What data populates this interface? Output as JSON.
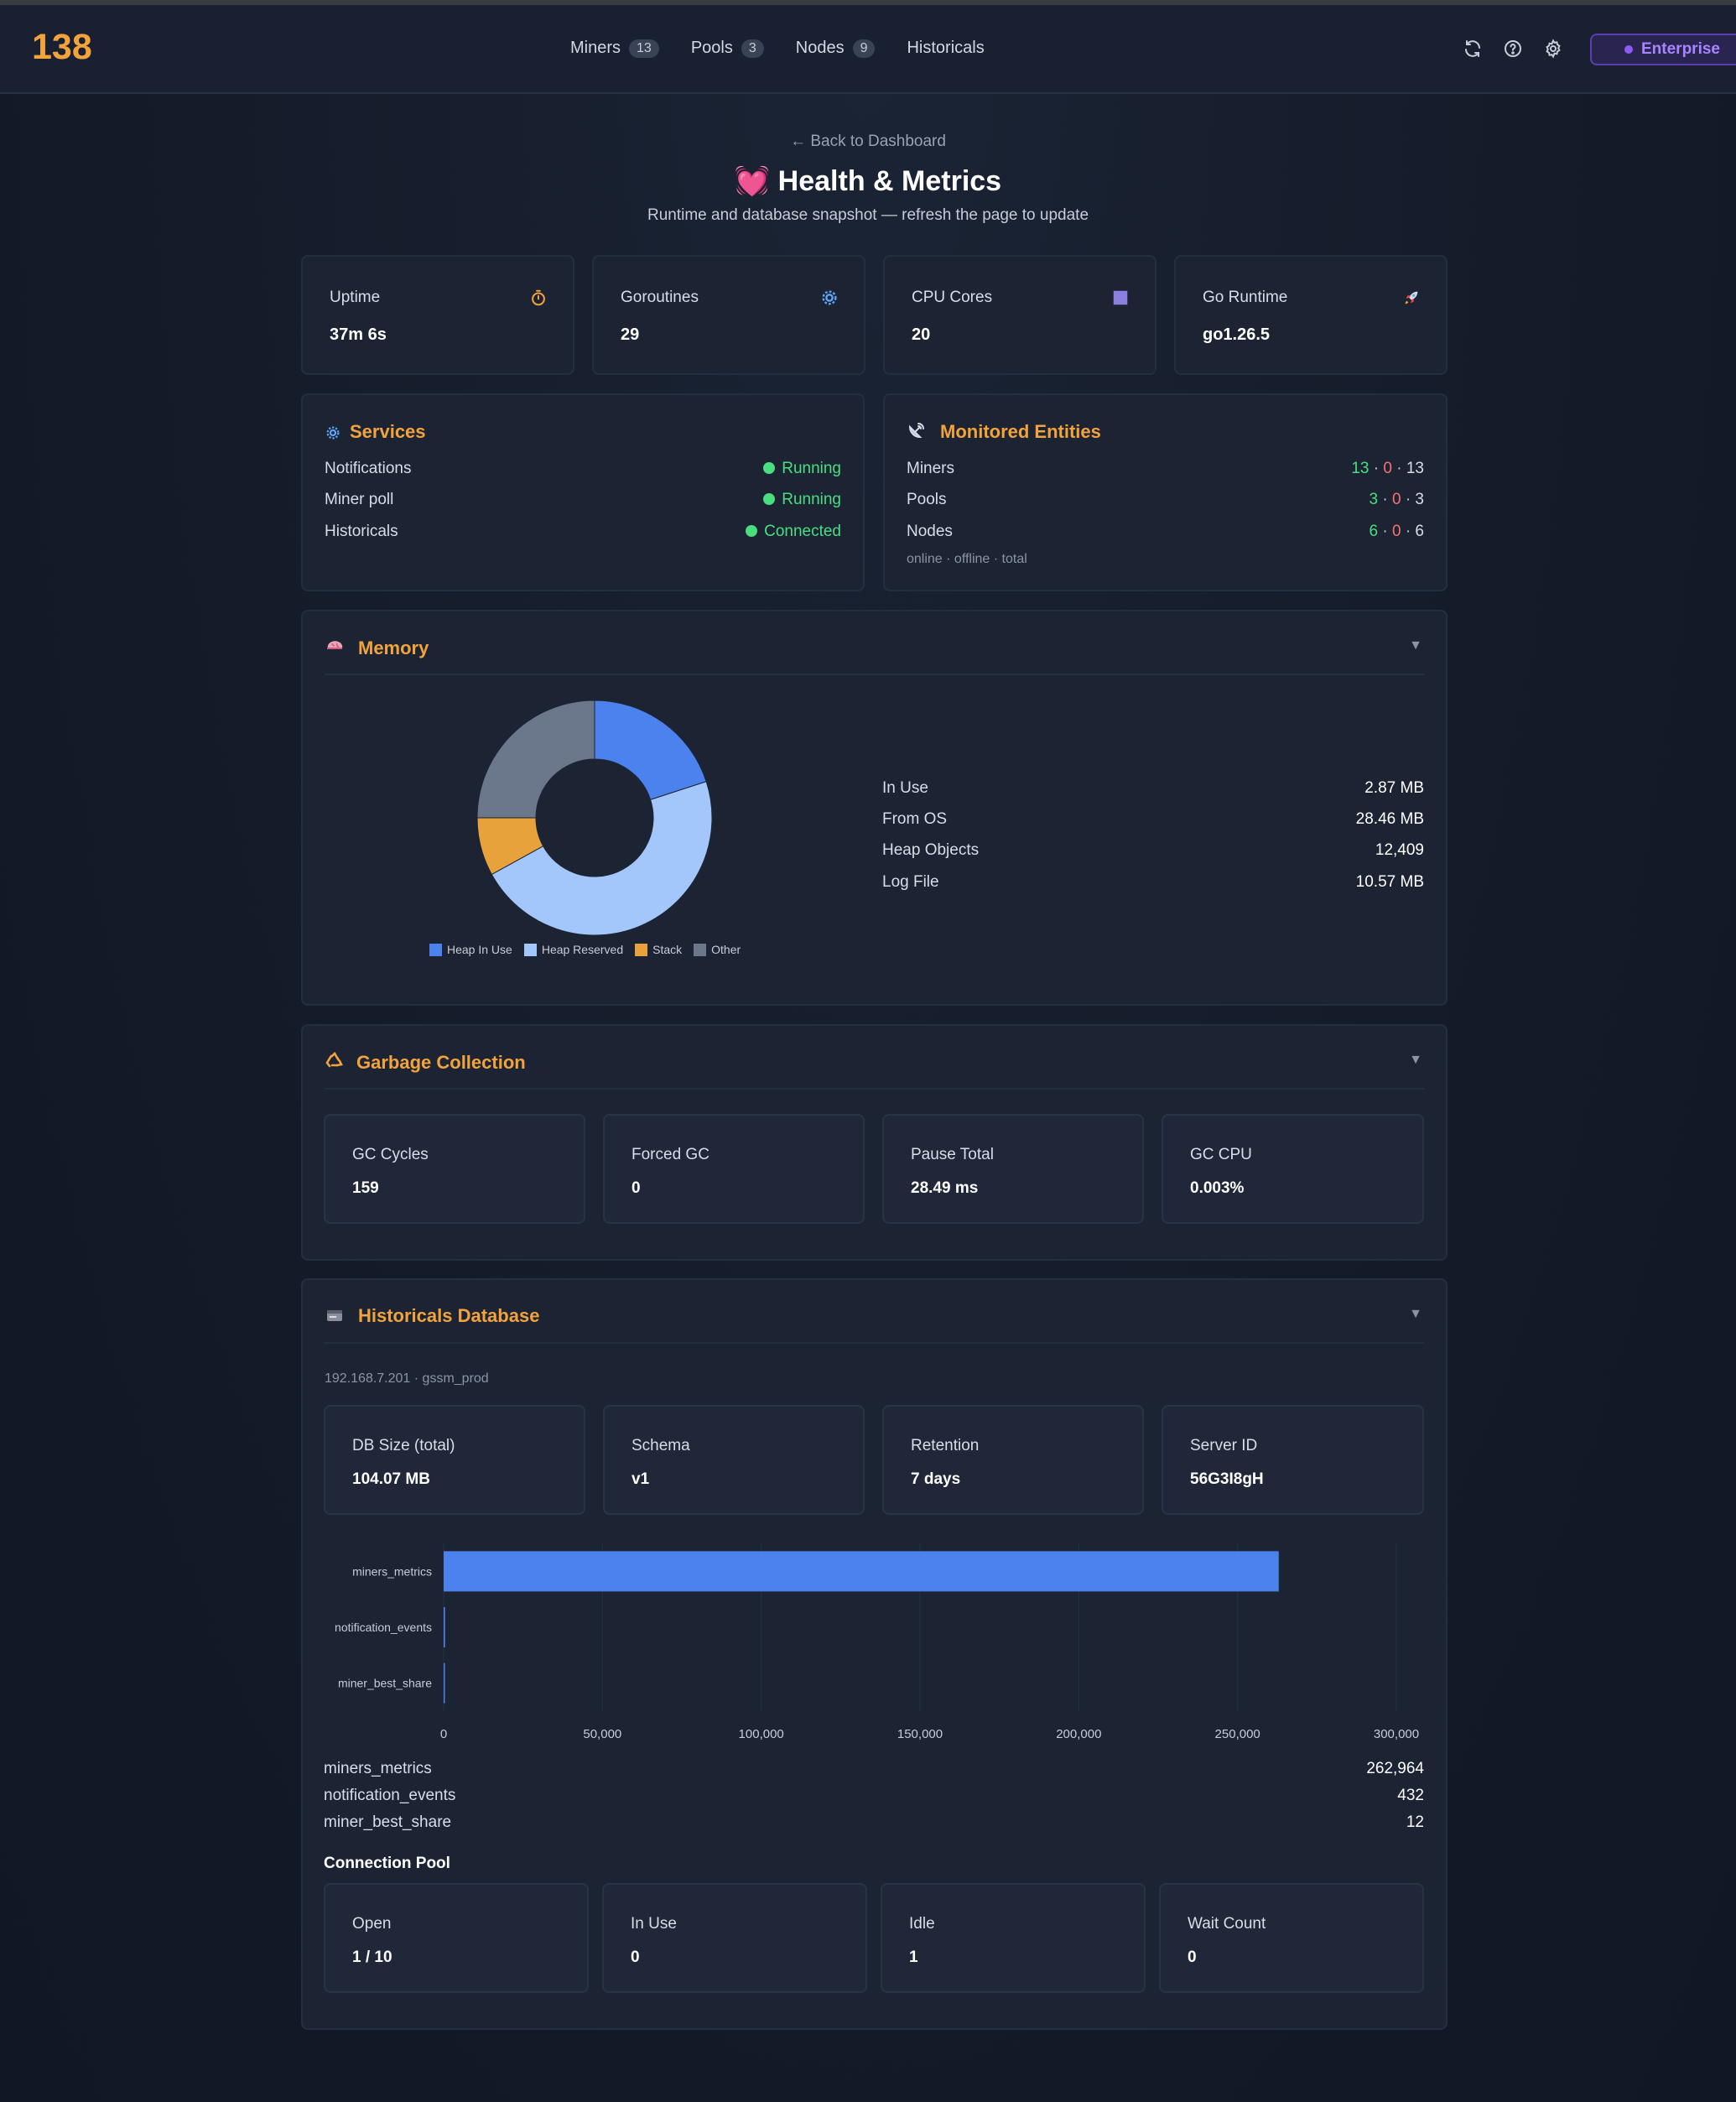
{
  "header": {
    "logo": "138",
    "nav": [
      {
        "label": "Miners",
        "count": "13"
      },
      {
        "label": "Pools",
        "count": "3"
      },
      {
        "label": "Nodes",
        "count": "9"
      },
      {
        "label": "Historicals",
        "count": null
      }
    ],
    "icons": [
      "refresh-icon",
      "help-icon",
      "gear-icon"
    ],
    "enterprise_label": "Enterprise"
  },
  "page": {
    "back_link": "← Back to Dashboard",
    "title": "💓 Health & Metrics",
    "subtitle": "Runtime and database snapshot — refresh the page to update"
  },
  "stats": [
    {
      "label": "Uptime",
      "value": "37m 6s",
      "icon": "timer-icon"
    },
    {
      "label": "Goroutines",
      "value": "29",
      "icon": "gear-icon"
    },
    {
      "label": "CPU Cores",
      "value": "20",
      "icon": "square-icon"
    },
    {
      "label": "Go Runtime",
      "value": "go1.26.5",
      "icon": "rocket-icon"
    }
  ],
  "services": {
    "title": "Services",
    "items": [
      {
        "label": "Notifications",
        "status": "Running"
      },
      {
        "label": "Miner poll",
        "status": "Running"
      },
      {
        "label": "Historicals",
        "status": "Connected"
      }
    ]
  },
  "entities": {
    "title": "Monitored Entities",
    "items": [
      {
        "label": "Miners",
        "online": "13",
        "offline": "0",
        "total": "13"
      },
      {
        "label": "Pools",
        "online": "3",
        "offline": "0",
        "total": "3"
      },
      {
        "label": "Nodes",
        "online": "6",
        "offline": "0",
        "total": "6"
      }
    ],
    "separator": "·",
    "legend": "online · offline · total"
  },
  "memory": {
    "title": "Memory",
    "collapse_glyph": "▼",
    "rows": [
      {
        "label": "In Use",
        "value": "2.87 MB"
      },
      {
        "label": "From OS",
        "value": "28.46 MB"
      },
      {
        "label": "Heap Objects",
        "value": "12,409"
      },
      {
        "label": "Log File",
        "value": "10.57 MB"
      }
    ]
  },
  "chart_data": [
    {
      "type": "pie",
      "categories": [
        "Heap In Use",
        "Heap Reserved",
        "Stack",
        "Other"
      ],
      "values": [
        20,
        47,
        8,
        25
      ],
      "colors": [
        "#4c82ee",
        "#a3c6fb",
        "#e8a23b",
        "#6b778b"
      ],
      "donut": true,
      "legend": "bottom"
    },
    {
      "type": "bar",
      "orientation": "horizontal",
      "categories": [
        "miners_metrics",
        "notification_events",
        "miner_best_share"
      ],
      "values": [
        262964,
        432,
        12
      ],
      "xlim": [
        0,
        300000
      ],
      "xticks": [
        "0",
        "50,000",
        "100,000",
        "150,000",
        "200,000",
        "250,000",
        "300,000"
      ],
      "color": "#4c82ee",
      "grid": true
    }
  ],
  "gc": {
    "title": "Garbage Collection",
    "collapse_glyph": "▼",
    "items": [
      {
        "label": "GC Cycles",
        "value": "159"
      },
      {
        "label": "Forced GC",
        "value": "0"
      },
      {
        "label": "Pause Total",
        "value": "28.49 ms"
      },
      {
        "label": "GC CPU",
        "value": "0.003%"
      }
    ]
  },
  "historicals_db": {
    "title": "Historicals Database",
    "collapse_glyph": "▼",
    "connection": "192.168.7.201 · gssm_prod",
    "items": [
      {
        "label": "DB Size (total)",
        "value": "104.07 MB"
      },
      {
        "label": "Schema",
        "value": "v1"
      },
      {
        "label": "Retention",
        "value": "7 days"
      },
      {
        "label": "Server ID",
        "value": "56G3I8gH"
      }
    ],
    "tables": [
      {
        "name": "miners_metrics",
        "rows": "262,964"
      },
      {
        "name": "notification_events",
        "rows": "432"
      },
      {
        "name": "miner_best_share",
        "rows": "12"
      }
    ],
    "pool_title": "Connection Pool",
    "pool": [
      {
        "label": "Open",
        "value": "1 / 10"
      },
      {
        "label": "In Use",
        "value": "0"
      },
      {
        "label": "Idle",
        "value": "1"
      },
      {
        "label": "Wait Count",
        "value": "0"
      }
    ]
  },
  "colors": {
    "accent": "#f2a33c",
    "success": "#4ade80",
    "danger": "#f87171",
    "enterprise": "#8b5cf6"
  }
}
